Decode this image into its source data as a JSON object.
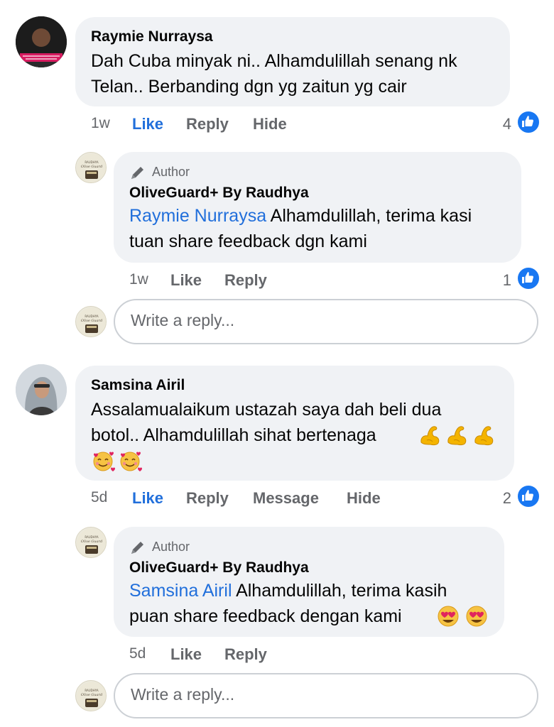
{
  "threads": [
    {
      "comment": {
        "author": "Raymie Nurraysa",
        "text_lines": [
          "Dah Cuba minyak ni.. Alhamdulillah senang nk",
          "Telan.. Berbanding dgn yg zaitun yg cair"
        ],
        "time": "1w",
        "actions": [
          "Like",
          "Reply",
          "Hide"
        ],
        "reaction_count": "4",
        "reaction_icon": "like-icon"
      },
      "reply": {
        "badge": "Author",
        "badge_icon": "pencil-icon",
        "author": "OliveGuard+ By Raudhya",
        "mention": "Raymie Nurraysa",
        "text_line1": " Alhamdulillah, terima kasi",
        "text_line2": "tuan share feedback dgn kami",
        "time": "1w",
        "actions": [
          "Like",
          "Reply"
        ],
        "reaction_count": "1"
      },
      "reply_input_placeholder": "Write a reply..."
    },
    {
      "comment": {
        "author": "Samsina Airil",
        "text_lines": [
          "Assalamualaikum ustazah saya dah beli dua",
          "botol.. Alhamdulillah sihat bertenaga"
        ],
        "emoji_line1": [
          "flexed-biceps-emoji",
          "flexed-biceps-emoji",
          "flexed-biceps-emoji"
        ],
        "emoji_line2": [
          "smiling-face-with-hearts-emoji",
          "smiling-face-with-hearts-emoji"
        ],
        "time": "5d",
        "actions": [
          "Like",
          "Reply",
          "Message",
          "Hide"
        ],
        "reaction_count": "2",
        "reaction_icon": "like-icon"
      },
      "reply": {
        "badge": "Author",
        "badge_icon": "pencil-icon",
        "author": "OliveGuard+ By Raudhya",
        "mention": "Samsina Airil",
        "text_line1": " Alhamdulillah, terima kasih",
        "text_line2": "puan share feedback dengan kami",
        "emoji_line2": [
          "heart-eyes-emoji",
          "heart-eyes-emoji"
        ],
        "time": "5d",
        "actions": [
          "Like",
          "Reply"
        ]
      },
      "reply_input_placeholder": "Write a reply..."
    }
  ],
  "colors": {
    "bubble": "#f0f2f5",
    "link_blue": "#216fdb",
    "meta_gray": "#65676b",
    "like_blue": "#1877f2"
  }
}
